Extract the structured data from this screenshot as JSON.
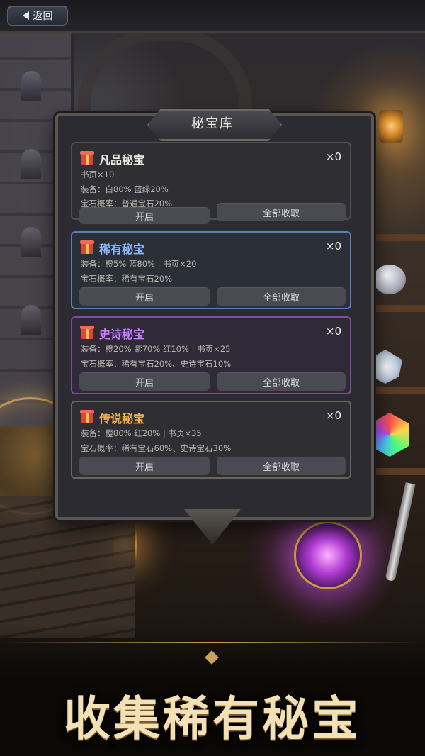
{
  "topbar": {
    "back_label": "返回"
  },
  "panel": {
    "title": "秘宝库"
  },
  "cards": [
    {
      "title": "凡品秘宝",
      "count": "×0",
      "lines": [
        "书页×10",
        "装备：白80% 蓝绿20%",
        "宝石概率：普通宝石20%"
      ],
      "open_label": "开启",
      "claim_label": "全部收取"
    },
    {
      "title": "稀有秘宝",
      "count": "×0",
      "lines": [
        "装备：橙5% 蓝80% | 书页×20",
        "宝石概率：稀有宝石20%"
      ],
      "open_label": "开启",
      "claim_label": "全部收取"
    },
    {
      "title": "史诗秘宝",
      "count": "×0",
      "lines": [
        "装备：橙20% 紫70% 红10% | 书页×25",
        "宝石概率：稀有宝石20%、史诗宝石10%"
      ],
      "open_label": "开启",
      "claim_label": "全部收取"
    },
    {
      "title": "传说秘宝",
      "count": "×0",
      "lines": [
        "装备：橙80% 红20% | 书页×35",
        "宝石概率：稀有宝石60%、史诗宝石30%"
      ],
      "open_label": "开启",
      "claim_label": "全部收取"
    }
  ],
  "slogan": "收集稀有秘宝",
  "colors": {
    "rare": "#8db8ff",
    "epic": "#c57cf5",
    "legend": "#f2b04b"
  }
}
